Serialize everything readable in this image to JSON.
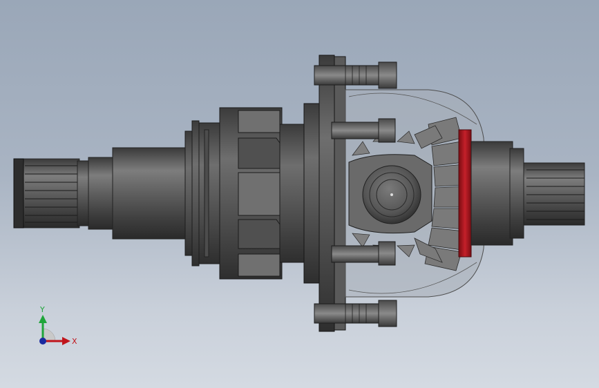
{
  "viewport": {
    "triad": {
      "x_label": "X",
      "y_label": "Y",
      "x_color": "#c0141b",
      "y_color": "#1fa53a",
      "z_color": "#1a2aa0"
    },
    "accent_color": "#b3141d"
  }
}
